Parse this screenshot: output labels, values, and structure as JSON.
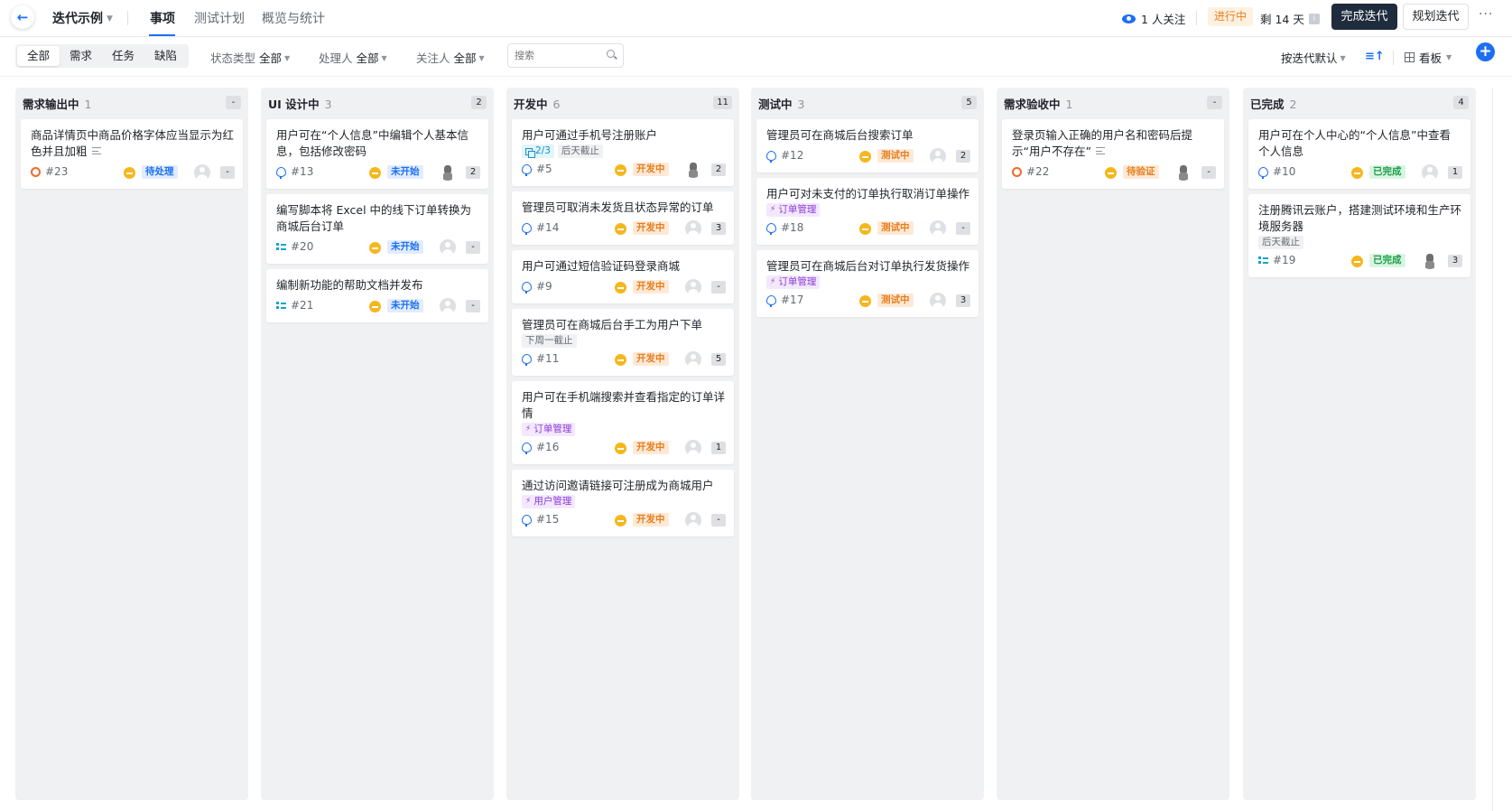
{
  "header": {
    "back_icon": "arrow-left-icon",
    "iteration_title": "迭代示例",
    "tabs": [
      {
        "label": "事项",
        "active": true
      },
      {
        "label": "测试计划",
        "active": false
      },
      {
        "label": "概览与统计",
        "active": false
      }
    ],
    "followers": "1 人关注",
    "status": "进行中",
    "remaining": "剩 14 天",
    "info_icon": "i",
    "complete_button": "完成迭代",
    "plan_button": "规划迭代",
    "more": "···"
  },
  "filters": {
    "types": [
      {
        "label": "全部",
        "active": true
      },
      {
        "label": "需求",
        "active": false
      },
      {
        "label": "任务",
        "active": false
      },
      {
        "label": "缺陷",
        "active": false
      }
    ],
    "status_type": {
      "label": "状态类型",
      "value": "全部"
    },
    "assignee": {
      "label": "处理人",
      "value": "全部"
    },
    "watcher": {
      "label": "关注人",
      "value": "全部"
    },
    "search_placeholder": "搜索",
    "sort": "按迭代默认",
    "view": "看板",
    "add": "+"
  },
  "columns": [
    {
      "name": "需求输出中",
      "count": "1",
      "badge": "-",
      "cards": [
        {
          "title": "商品详情页中商品价格字体应当显示为红色并且加粗",
          "desc": true,
          "type": "defect",
          "id": "#23",
          "status": "待处理",
          "st": "wait",
          "avatar": "placeholder",
          "pts": "-"
        }
      ]
    },
    {
      "name": "UI 设计中",
      "count": "3",
      "badge": "2",
      "cards": [
        {
          "title": "用户可在“个人信息”中编辑个人基本信息，包括修改密码",
          "type": "req",
          "id": "#13",
          "status": "未开始",
          "st": "todo",
          "avatar": "owl",
          "pts": "2"
        },
        {
          "title": "编写脚本将 Excel 中的线下订单转换为商城后台订单",
          "type": "task",
          "id": "#20",
          "status": "未开始",
          "st": "todo",
          "avatar": "placeholder",
          "pts": "-"
        },
        {
          "title": "编制新功能的帮助文档并发布",
          "type": "task",
          "id": "#21",
          "status": "未开始",
          "st": "todo",
          "avatar": "placeholder",
          "pts": "-"
        }
      ]
    },
    {
      "name": "开发中",
      "count": "6",
      "badge": "11",
      "cards": [
        {
          "title": "用户可通过手机号注册账户",
          "tags": [
            {
              "text": "2/3",
              "kind": "cyan",
              "icon": "subtask"
            },
            {
              "text": "后天截止",
              "kind": "gray"
            }
          ],
          "type": "req",
          "id": "#5",
          "status": "开发中",
          "st": "dev",
          "avatar": "owl",
          "pts": "2"
        },
        {
          "title": "管理员可取消未发货且状态异常的订单",
          "type": "req",
          "id": "#14",
          "status": "开发中",
          "st": "dev",
          "avatar": "placeholder",
          "pts": "3"
        },
        {
          "title": "用户可通过短信验证码登录商城",
          "type": "req",
          "id": "#9",
          "status": "开发中",
          "st": "dev",
          "avatar": "placeholder",
          "pts": "-"
        },
        {
          "title": "管理员可在商城后台手工为用户下单",
          "tags": [
            {
              "text": "下周一截止",
              "kind": "gray"
            }
          ],
          "type": "req",
          "id": "#11",
          "status": "开发中",
          "st": "dev",
          "avatar": "placeholder",
          "pts": "5"
        },
        {
          "title": "用户可在手机端搜索并查看指定的订单详情",
          "tags": [
            {
              "text": "订单管理",
              "kind": "purple",
              "icon": "bolt"
            }
          ],
          "type": "req",
          "id": "#16",
          "status": "开发中",
          "st": "dev",
          "avatar": "placeholder",
          "pts": "1"
        },
        {
          "title": "通过访问邀请链接可注册成为商城用户",
          "tags": [
            {
              "text": "用户管理",
              "kind": "purple",
              "icon": "bolt"
            }
          ],
          "type": "req",
          "id": "#15",
          "status": "开发中",
          "st": "dev",
          "avatar": "placeholder",
          "pts": "-"
        }
      ]
    },
    {
      "name": "测试中",
      "count": "3",
      "badge": "5",
      "cards": [
        {
          "title": "管理员可在商城后台搜索订单",
          "type": "req",
          "id": "#12",
          "status": "测试中",
          "st": "test",
          "avatar": "placeholder",
          "pts": "2"
        },
        {
          "title": "用户可对未支付的订单执行取消订单操作",
          "tags": [
            {
              "text": "订单管理",
              "kind": "purple",
              "icon": "bolt"
            }
          ],
          "type": "req",
          "id": "#18",
          "status": "测试中",
          "st": "test",
          "avatar": "placeholder",
          "pts": "-"
        },
        {
          "title": "管理员可在商城后台对订单执行发货操作",
          "tags": [
            {
              "text": "订单管理",
              "kind": "purple",
              "icon": "bolt"
            }
          ],
          "type": "req",
          "id": "#17",
          "status": "测试中",
          "st": "test",
          "avatar": "placeholder",
          "pts": "3"
        }
      ]
    },
    {
      "name": "需求验收中",
      "count": "1",
      "badge": "-",
      "cards": [
        {
          "title": "登录页输入正确的用户名和密码后提示“用户不存在”",
          "desc": true,
          "type": "defect",
          "id": "#22",
          "status": "待验证",
          "st": "verify",
          "avatar": "owl",
          "pts": "-"
        }
      ]
    },
    {
      "name": "已完成",
      "count": "2",
      "badge": "4",
      "cards": [
        {
          "title": "用户可在个人中心的“个人信息”中查看个人信息",
          "type": "req",
          "id": "#10",
          "status": "已完成",
          "st": "done",
          "avatar": "placeholder",
          "pts": "1"
        },
        {
          "title": "注册腾讯云账户，搭建测试环境和生产环境服务器",
          "tags": [
            {
              "text": "后天截止",
              "kind": "gray"
            }
          ],
          "type": "task",
          "id": "#19",
          "status": "已完成",
          "st": "done",
          "avatar": "owl",
          "pts": "3"
        }
      ]
    }
  ]
}
